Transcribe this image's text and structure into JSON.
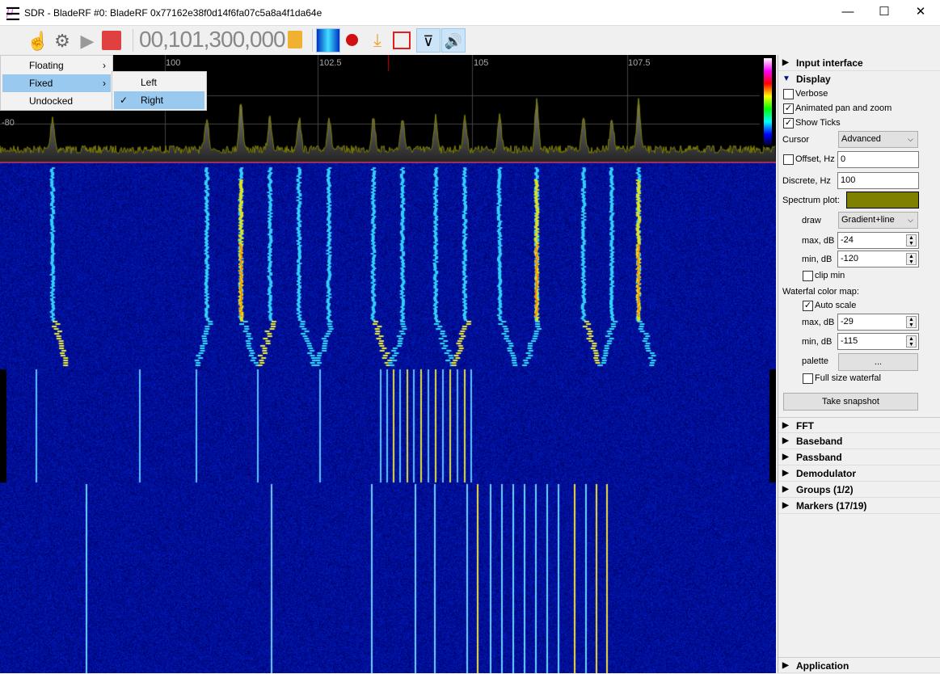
{
  "window": {
    "title": "SDR - BladeRF #0: BladeRF 0x77162e38f0d14f6fa07c5a8a4f1da64e",
    "minimize": "—",
    "maximize": "☐",
    "close": "✕"
  },
  "toolbar": {
    "frequency": "00,101,300,000",
    "icons": [
      "menu-icon",
      "hand-icon",
      "gear-icon",
      "play-icon",
      "stop-icon",
      "lock-icon",
      "waterfall-icon",
      "record-icon",
      "download-icon",
      "crop-icon",
      "filter-icon",
      "speaker-icon"
    ]
  },
  "menu": {
    "items": [
      {
        "label": "Floating",
        "arrow": "›"
      },
      {
        "label": "Fixed",
        "arrow": "›"
      },
      {
        "label": "Undocked"
      }
    ],
    "submenu": [
      {
        "label": "Left"
      },
      {
        "label": "Right",
        "check": "✓"
      }
    ]
  },
  "spectrum": {
    "freq_ticks": [
      "100",
      "102.5",
      "105",
      "107.5"
    ],
    "db_label": "-80",
    "plot_color": "#7f7f00"
  },
  "panel": {
    "input_interface": "Input interface",
    "display": "Display",
    "verbose": {
      "label": "Verbose",
      "checked": false
    },
    "animated": {
      "label": "Animated pan and zoom",
      "checked": true
    },
    "show_ticks": {
      "label": "Show Ticks",
      "checked": true
    },
    "cursor": {
      "label": "Cursor",
      "value": "Advanced"
    },
    "offset": {
      "label": "Offset, Hz",
      "value": "0",
      "checked": false
    },
    "discrete": {
      "label": "Discrete, Hz",
      "value": "100"
    },
    "spectrum_plot": {
      "label": "Spectrum plot:",
      "color": "#808000"
    },
    "draw": {
      "label": "draw",
      "value": "Gradient+line"
    },
    "spec_max": {
      "label": "max, dB",
      "value": "-24"
    },
    "spec_min": {
      "label": "min, dB",
      "value": "-120"
    },
    "clip_min": {
      "label": "clip min",
      "checked": false
    },
    "wf_map": "Waterfal color map:",
    "auto_scale": {
      "label": "Auto scale",
      "checked": true
    },
    "wf_max": {
      "label": "max, dB",
      "value": "-29"
    },
    "wf_min": {
      "label": "min, dB",
      "value": "-115"
    },
    "palette": {
      "label": "palette",
      "button": "..."
    },
    "full_size": {
      "label": "Full size waterfal",
      "checked": false
    },
    "snapshot": "Take snapshot",
    "sections": [
      "FFT",
      "Baseband",
      "Passband",
      "Demodulator",
      "Groups (1/2)",
      "Markers (17/19)"
    ],
    "application": "Application",
    "check": "✓",
    "tri_closed": "▶",
    "tri_open": "▼",
    "dd": "⌵"
  }
}
